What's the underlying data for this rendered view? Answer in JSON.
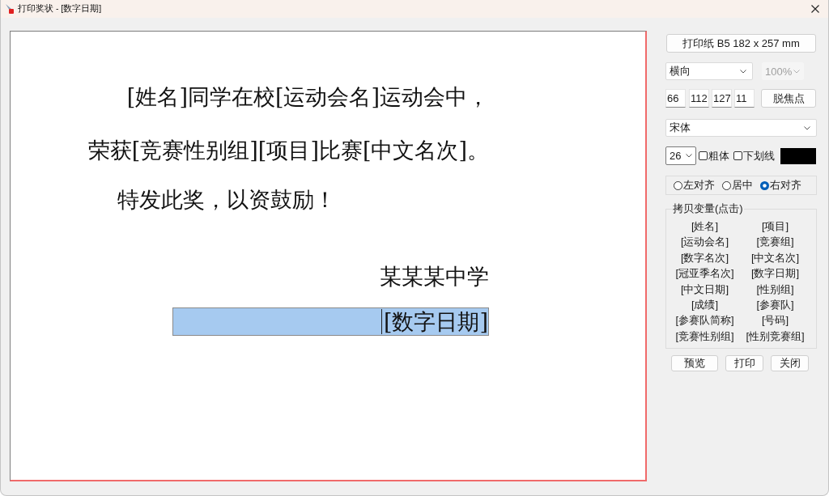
{
  "window": {
    "title": "打印奖状 - [数字日期]"
  },
  "canvas": {
    "lines": [
      {
        "text": "[姓名]同学在校[运动会名]运动会中，",
        "selected": false
      },
      {
        "text": "荣获[竞赛性别组][项目]比赛[中文名次]。",
        "selected": false
      },
      {
        "text": "特发此奖，以资鼓励！",
        "selected": false
      },
      {
        "text": "某某某中学",
        "selected": false
      },
      {
        "text": "[数字日期]",
        "selected": true
      }
    ]
  },
  "panel": {
    "paper_button": "打印纸 B5 182 x 257 mm",
    "orientation": {
      "value": "横向",
      "disabled": false
    },
    "zoom": {
      "value": "100%",
      "disabled": true
    },
    "margins": [
      "66",
      "112",
      "127",
      "11"
    ],
    "blur_button": "脱焦点",
    "font": {
      "value": "宋体"
    },
    "font_size": {
      "value": "26"
    },
    "style_options": [
      {
        "label": "粗体",
        "checked": false
      },
      {
        "label": "下划线",
        "checked": false
      }
    ],
    "text_color": {
      "color": "#000000"
    },
    "alignment": [
      {
        "label": "左对齐",
        "selected": false
      },
      {
        "label": "居中",
        "selected": false
      },
      {
        "label": "右对齐",
        "selected": true
      }
    ],
    "variables": {
      "title": "拷贝变量(点击)",
      "items": [
        "[姓名]",
        "[项目]",
        "[运动会名]",
        "[竞赛组]",
        "[数字名次]",
        "[中文名次]",
        "[冠亚季名次]",
        "[数字日期]",
        "[中文日期]",
        "[性别组]",
        "[成绩]",
        "[参赛队]",
        "[参赛队简称]",
        "[号码]",
        "[竞赛性别组]",
        "[性别竞赛组]"
      ]
    },
    "buttons": [
      "预览",
      "打印",
      "关闭"
    ]
  }
}
